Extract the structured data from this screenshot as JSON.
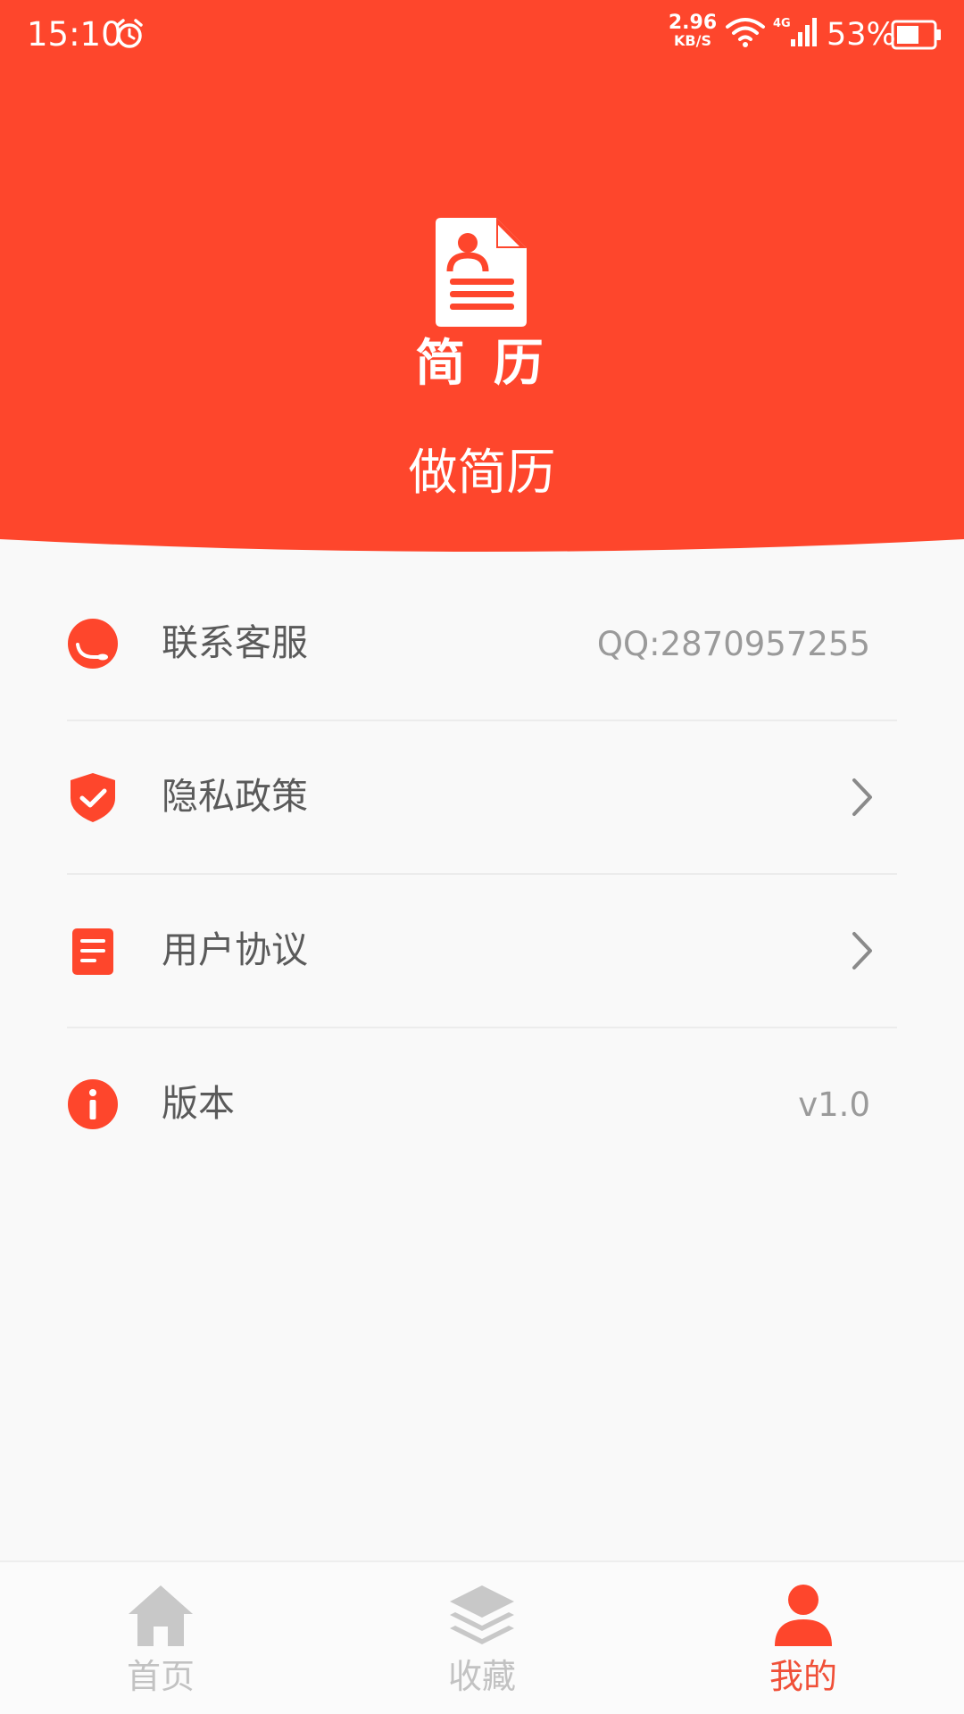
{
  "status_bar": {
    "time": "15:10",
    "net_speed_value": "2.96",
    "net_speed_unit": "KB/S",
    "network_type": "4G",
    "battery_percent": "53%"
  },
  "header": {
    "logo_caption": "简 历",
    "title": "做简历"
  },
  "menu": {
    "items": [
      {
        "label": "联系客服",
        "value": "QQ:2870957255",
        "icon": "headset-icon"
      },
      {
        "label": "隐私政策",
        "value": "",
        "icon": "shield-check-icon"
      },
      {
        "label": "用户协议",
        "value": "",
        "icon": "document-icon"
      },
      {
        "label": "版本",
        "value": "v1.0",
        "icon": "info-icon"
      }
    ]
  },
  "bottom_nav": {
    "tabs": [
      {
        "label": "首页",
        "icon": "home-icon",
        "active": false
      },
      {
        "label": "收藏",
        "icon": "layers-icon",
        "active": false
      },
      {
        "label": "我的",
        "icon": "person-icon",
        "active": true
      }
    ]
  },
  "colors": {
    "primary": "#fe462c",
    "background": "#f9f9f9",
    "label_text": "#5a5a5a",
    "secondary_text": "#9a9a9a",
    "nav_inactive": "#c2c2c2",
    "nav_active": "#f05038"
  }
}
